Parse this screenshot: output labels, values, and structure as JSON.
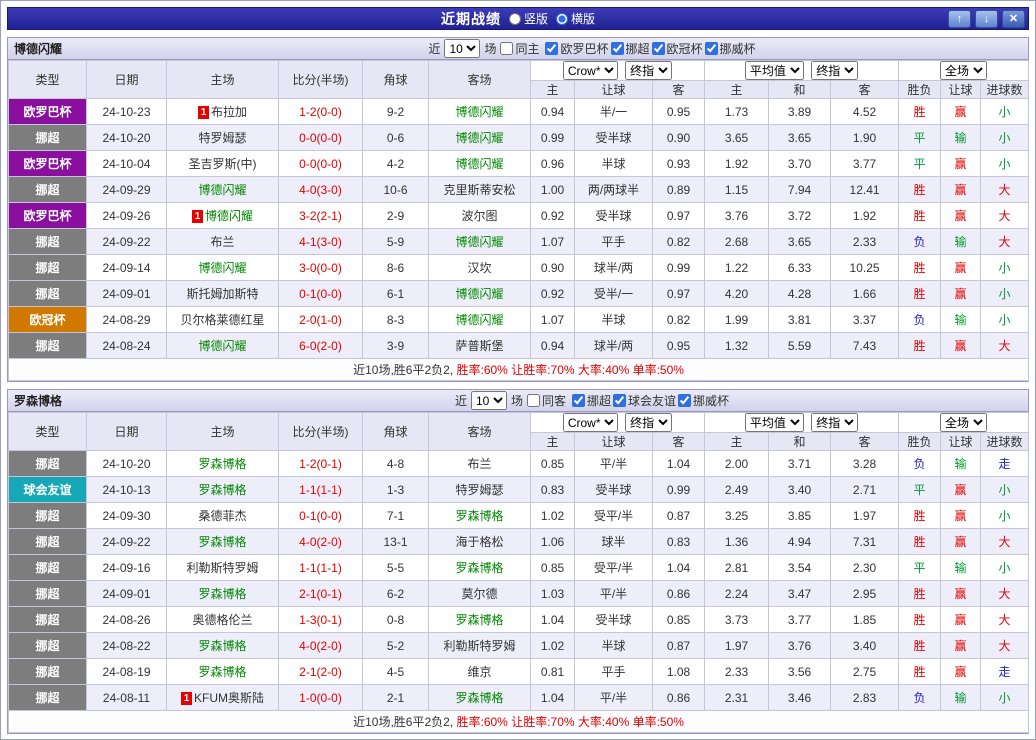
{
  "colors": {
    "score": "#e60000",
    "focus_team": "#008800",
    "win": "#e60000",
    "draw": "#009933",
    "lose": "#2222cc",
    "league": {
      "欧罗巴杯": "#8a0f9e",
      "挪超": "#7d7d7d",
      "欧冠杯": "#d07800",
      "球会友谊": "#17a8b8"
    }
  },
  "titlebar": {
    "title": "近期战绩",
    "radios": [
      {
        "label": "竖版",
        "checked": false
      },
      {
        "label": "横版",
        "checked": true
      }
    ],
    "up_button": "↑",
    "down_button": "↓",
    "close_button": "✕"
  },
  "filter": {
    "near": "近",
    "count": "10",
    "games": "场"
  },
  "table_header": {
    "type": "类型",
    "date": "日期",
    "home": "主场",
    "score": "比分(半场)",
    "corner": "角球",
    "away": "客场",
    "odds_source_select": "Crow*",
    "odds_final_select": "终指",
    "avg_source_select": "平均值",
    "avg_final_select": "终指",
    "scope_select": "全场",
    "odds_home": "主",
    "odds_handicap": "让球",
    "odds_away": "客",
    "avg_home": "主",
    "avg_draw": "和",
    "avg_away": "客",
    "result": "胜负",
    "handicap_result": "让球",
    "goals": "进球数"
  },
  "sections": [
    {
      "team": "博德闪耀",
      "same_label": "同主",
      "same_checked": false,
      "leagues": [
        {
          "label": "欧罗巴杯",
          "checked": true
        },
        {
          "label": "挪超",
          "checked": true
        },
        {
          "label": "欧冠杯",
          "checked": true
        },
        {
          "label": "挪威杯",
          "checked": true
        }
      ],
      "rows": [
        {
          "league": "欧罗巴杯",
          "date": "24-10-23",
          "home": "布拉加",
          "home_mark": "1",
          "home_focus": false,
          "score": "1-2(0-0)",
          "corner": "9-2",
          "away": "博德闪耀",
          "away_focus": true,
          "odds_home": "0.94",
          "handicap": "半/一",
          "odds_away": "0.95",
          "avg_home": "1.73",
          "avg_draw": "3.89",
          "avg_away": "4.52",
          "result": "胜",
          "handicap_result": "赢",
          "goals": "小"
        },
        {
          "league": "挪超",
          "date": "24-10-20",
          "home": "特罗姆瑟",
          "home_focus": false,
          "score": "0-0(0-0)",
          "corner": "0-6",
          "away": "博德闪耀",
          "away_focus": true,
          "odds_home": "0.99",
          "handicap": "受半球",
          "odds_away": "0.90",
          "avg_home": "3.65",
          "avg_draw": "3.65",
          "avg_away": "1.90",
          "result": "平",
          "handicap_result": "输",
          "goals": "小"
        },
        {
          "league": "欧罗巴杯",
          "date": "24-10-04",
          "home": "圣吉罗斯(中)",
          "home_focus": false,
          "score": "0-0(0-0)",
          "corner": "4-2",
          "away": "博德闪耀",
          "away_focus": true,
          "odds_home": "0.96",
          "handicap": "半球",
          "odds_away": "0.93",
          "avg_home": "1.92",
          "avg_draw": "3.70",
          "avg_away": "3.77",
          "result": "平",
          "handicap_result": "赢",
          "goals": "小"
        },
        {
          "league": "挪超",
          "date": "24-09-29",
          "home": "博德闪耀",
          "home_focus": true,
          "score": "4-0(3-0)",
          "corner": "10-6",
          "away": "克里斯蒂安松",
          "away_focus": false,
          "odds_home": "1.00",
          "handicap": "两/两球半",
          "odds_away": "0.89",
          "avg_home": "1.15",
          "avg_draw": "7.94",
          "avg_away": "12.41",
          "result": "胜",
          "handicap_result": "赢",
          "goals": "大"
        },
        {
          "league": "欧罗巴杯",
          "date": "24-09-26",
          "home": "博德闪耀",
          "home_mark": "1",
          "home_focus": true,
          "score": "3-2(2-1)",
          "corner": "2-9",
          "away": "波尔图",
          "away_focus": false,
          "odds_home": "0.92",
          "handicap": "受半球",
          "odds_away": "0.97",
          "avg_home": "3.76",
          "avg_draw": "3.72",
          "avg_away": "1.92",
          "result": "胜",
          "handicap_result": "赢",
          "goals": "大"
        },
        {
          "league": "挪超",
          "date": "24-09-22",
          "home": "布兰",
          "home_focus": false,
          "score": "4-1(3-0)",
          "corner": "5-9",
          "away": "博德闪耀",
          "away_focus": true,
          "odds_home": "1.07",
          "handicap": "平手",
          "odds_away": "0.82",
          "avg_home": "2.68",
          "avg_draw": "3.65",
          "avg_away": "2.33",
          "result": "负",
          "handicap_result": "输",
          "goals": "大"
        },
        {
          "league": "挪超",
          "date": "24-09-14",
          "home": "博德闪耀",
          "home_focus": true,
          "score": "3-0(0-0)",
          "corner": "8-6",
          "away": "汉坎",
          "away_focus": false,
          "odds_home": "0.90",
          "handicap": "球半/两",
          "odds_away": "0.99",
          "avg_home": "1.22",
          "avg_draw": "6.33",
          "avg_away": "10.25",
          "result": "胜",
          "handicap_result": "赢",
          "goals": "小"
        },
        {
          "league": "挪超",
          "date": "24-09-01",
          "home": "斯托姆加斯特",
          "home_focus": false,
          "score": "0-1(0-0)",
          "corner": "6-1",
          "away": "博德闪耀",
          "away_focus": true,
          "odds_home": "0.92",
          "handicap": "受半/一",
          "odds_away": "0.97",
          "avg_home": "4.20",
          "avg_draw": "4.28",
          "avg_away": "1.66",
          "result": "胜",
          "handicap_result": "赢",
          "goals": "小"
        },
        {
          "league": "欧冠杯",
          "date": "24-08-29",
          "home": "贝尔格莱德红星",
          "home_focus": false,
          "score": "2-0(1-0)",
          "corner": "8-3",
          "away": "博德闪耀",
          "away_focus": true,
          "odds_home": "1.07",
          "handicap": "半球",
          "odds_away": "0.82",
          "avg_home": "1.99",
          "avg_draw": "3.81",
          "avg_away": "3.37",
          "result": "负",
          "handicap_result": "输",
          "goals": "小"
        },
        {
          "league": "挪超",
          "date": "24-08-24",
          "home": "博德闪耀",
          "home_focus": true,
          "score": "6-0(2-0)",
          "corner": "3-9",
          "away": "萨普斯堡",
          "away_focus": false,
          "odds_home": "0.94",
          "handicap": "球半/两",
          "odds_away": "0.95",
          "avg_home": "1.32",
          "avg_draw": "5.59",
          "avg_away": "7.43",
          "result": "胜",
          "handicap_result": "赢",
          "goals": "大"
        }
      ],
      "footer": [
        {
          "text": "近10场,胜6平2负2, ",
          "color": "#333333"
        },
        {
          "text": "胜率:60%",
          "color": "#e60000"
        },
        {
          "text": " 让胜率:70%",
          "color": "#e60000"
        },
        {
          "text": " 大率:40%",
          "color": "#e60000"
        },
        {
          "text": " 单率:50%",
          "color": "#e60000"
        }
      ]
    },
    {
      "team": "罗森博格",
      "same_label": "同客",
      "same_checked": false,
      "leagues": [
        {
          "label": "挪超",
          "checked": true
        },
        {
          "label": "球会友谊",
          "checked": true
        },
        {
          "label": "挪威杯",
          "checked": true
        }
      ],
      "rows": [
        {
          "league": "挪超",
          "date": "24-10-20",
          "home": "罗森博格",
          "home_focus": true,
          "score": "1-2(0-1)",
          "corner": "4-8",
          "away": "布兰",
          "away_focus": false,
          "odds_home": "0.85",
          "handicap": "平/半",
          "odds_away": "1.04",
          "avg_home": "2.00",
          "avg_draw": "3.71",
          "avg_away": "3.28",
          "result": "负",
          "handicap_result": "输",
          "goals": "走"
        },
        {
          "league": "球会友谊",
          "date": "24-10-13",
          "home": "罗森博格",
          "home_focus": true,
          "score": "1-1(1-1)",
          "corner": "1-3",
          "away": "特罗姆瑟",
          "away_focus": false,
          "odds_home": "0.83",
          "handicap": "受半球",
          "odds_away": "0.99",
          "avg_home": "2.49",
          "avg_draw": "3.40",
          "avg_away": "2.71",
          "result": "平",
          "handicap_result": "赢",
          "goals": "小"
        },
        {
          "league": "挪超",
          "date": "24-09-30",
          "home": "桑德菲杰",
          "home_focus": false,
          "score": "0-1(0-0)",
          "corner": "7-1",
          "away": "罗森博格",
          "away_focus": true,
          "odds_home": "1.02",
          "handicap": "受平/半",
          "odds_away": "0.87",
          "avg_home": "3.25",
          "avg_draw": "3.85",
          "avg_away": "1.97",
          "result": "胜",
          "handicap_result": "赢",
          "goals": "小"
        },
        {
          "league": "挪超",
          "date": "24-09-22",
          "home": "罗森博格",
          "home_focus": true,
          "score": "4-0(2-0)",
          "corner": "13-1",
          "away": "海于格松",
          "away_focus": false,
          "odds_home": "1.06",
          "handicap": "球半",
          "odds_away": "0.83",
          "avg_home": "1.36",
          "avg_draw": "4.94",
          "avg_away": "7.31",
          "result": "胜",
          "handicap_result": "赢",
          "goals": "大"
        },
        {
          "league": "挪超",
          "date": "24-09-16",
          "home": "利勒斯特罗姆",
          "home_focus": false,
          "score": "1-1(1-1)",
          "corner": "5-5",
          "away": "罗森博格",
          "away_focus": true,
          "odds_home": "0.85",
          "handicap": "受平/半",
          "odds_away": "1.04",
          "avg_home": "2.81",
          "avg_draw": "3.54",
          "avg_away": "2.30",
          "result": "平",
          "handicap_result": "输",
          "goals": "小"
        },
        {
          "league": "挪超",
          "date": "24-09-01",
          "home": "罗森博格",
          "home_focus": true,
          "score": "2-1(0-1)",
          "corner": "6-2",
          "away": "莫尔德",
          "away_focus": false,
          "odds_home": "1.03",
          "handicap": "平/半",
          "odds_away": "0.86",
          "avg_home": "2.24",
          "avg_draw": "3.47",
          "avg_away": "2.95",
          "result": "胜",
          "handicap_result": "赢",
          "goals": "大"
        },
        {
          "league": "挪超",
          "date": "24-08-26",
          "home": "奥德格伦兰",
          "home_focus": false,
          "score": "1-3(0-1)",
          "corner": "0-8",
          "away": "罗森博格",
          "away_focus": true,
          "odds_home": "1.04",
          "handicap": "受半球",
          "odds_away": "0.85",
          "avg_home": "3.73",
          "avg_draw": "3.77",
          "avg_away": "1.85",
          "result": "胜",
          "handicap_result": "赢",
          "goals": "大"
        },
        {
          "league": "挪超",
          "date": "24-08-22",
          "home": "罗森博格",
          "home_focus": true,
          "score": "4-0(2-0)",
          "corner": "5-2",
          "away": "利勒斯特罗姆",
          "away_focus": false,
          "odds_home": "1.02",
          "handicap": "半球",
          "odds_away": "0.87",
          "avg_home": "1.97",
          "avg_draw": "3.76",
          "avg_away": "3.40",
          "result": "胜",
          "handicap_result": "赢",
          "goals": "大"
        },
        {
          "league": "挪超",
          "date": "24-08-19",
          "home": "罗森博格",
          "home_focus": true,
          "score": "2-1(2-0)",
          "corner": "4-5",
          "away": "维京",
          "away_focus": false,
          "odds_home": "0.81",
          "handicap": "平手",
          "odds_away": "1.08",
          "avg_home": "2.33",
          "avg_draw": "3.56",
          "avg_away": "2.75",
          "result": "胜",
          "handicap_result": "赢",
          "goals": "走"
        },
        {
          "league": "挪超",
          "date": "24-08-11",
          "home": "KFUM奥斯陆",
          "home_mark": "1",
          "home_focus": false,
          "score": "1-0(0-0)",
          "corner": "2-1",
          "away": "罗森博格",
          "away_focus": true,
          "odds_home": "1.04",
          "handicap": "平/半",
          "odds_away": "0.86",
          "avg_home": "2.31",
          "avg_draw": "3.46",
          "avg_away": "2.83",
          "result": "负",
          "handicap_result": "输",
          "goals": "小"
        }
      ],
      "footer": [
        {
          "text": "近10场,胜6平2负2, ",
          "color": "#333333"
        },
        {
          "text": "胜率:60%",
          "color": "#e60000"
        },
        {
          "text": " 让胜率:70%",
          "color": "#e60000"
        },
        {
          "text": " 大率:40%",
          "color": "#e60000"
        },
        {
          "text": " 单率:50%",
          "color": "#e60000"
        }
      ]
    }
  ]
}
